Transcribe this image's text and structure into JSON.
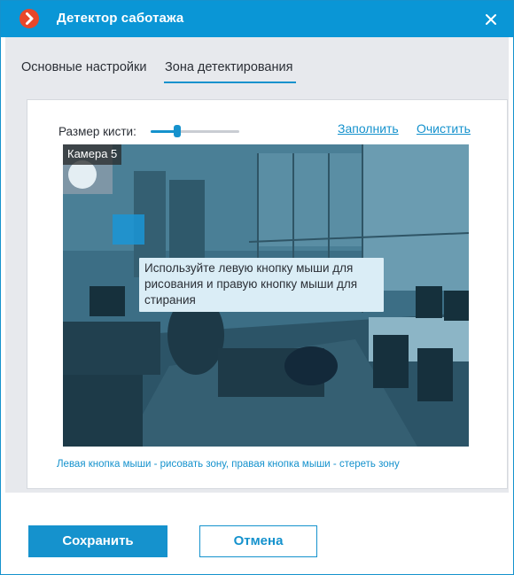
{
  "window": {
    "title": "Детектор саботажа",
    "accent": "#0a96d6",
    "logo_color": "#e8472b"
  },
  "tabs": [
    {
      "label": "Основные настройки",
      "active": false
    },
    {
      "label": "Зона детектирования",
      "active": true
    }
  ],
  "toolbar": {
    "brush_size_label": "Размер кисти:",
    "brush_size_fraction": 0.3,
    "fill_link": "Заполнить",
    "clear_link": "Очистить"
  },
  "camera": {
    "name": "Камера 5",
    "tooltip": "Используйте левую кнопку мыши для рисования и правую кнопку мыши для стирания"
  },
  "hint": "Левая кнопка мыши - рисовать зону, правая кнопка мыши - стереть зону",
  "footer": {
    "save_label": "Сохранить",
    "cancel_label": "Отмена"
  }
}
